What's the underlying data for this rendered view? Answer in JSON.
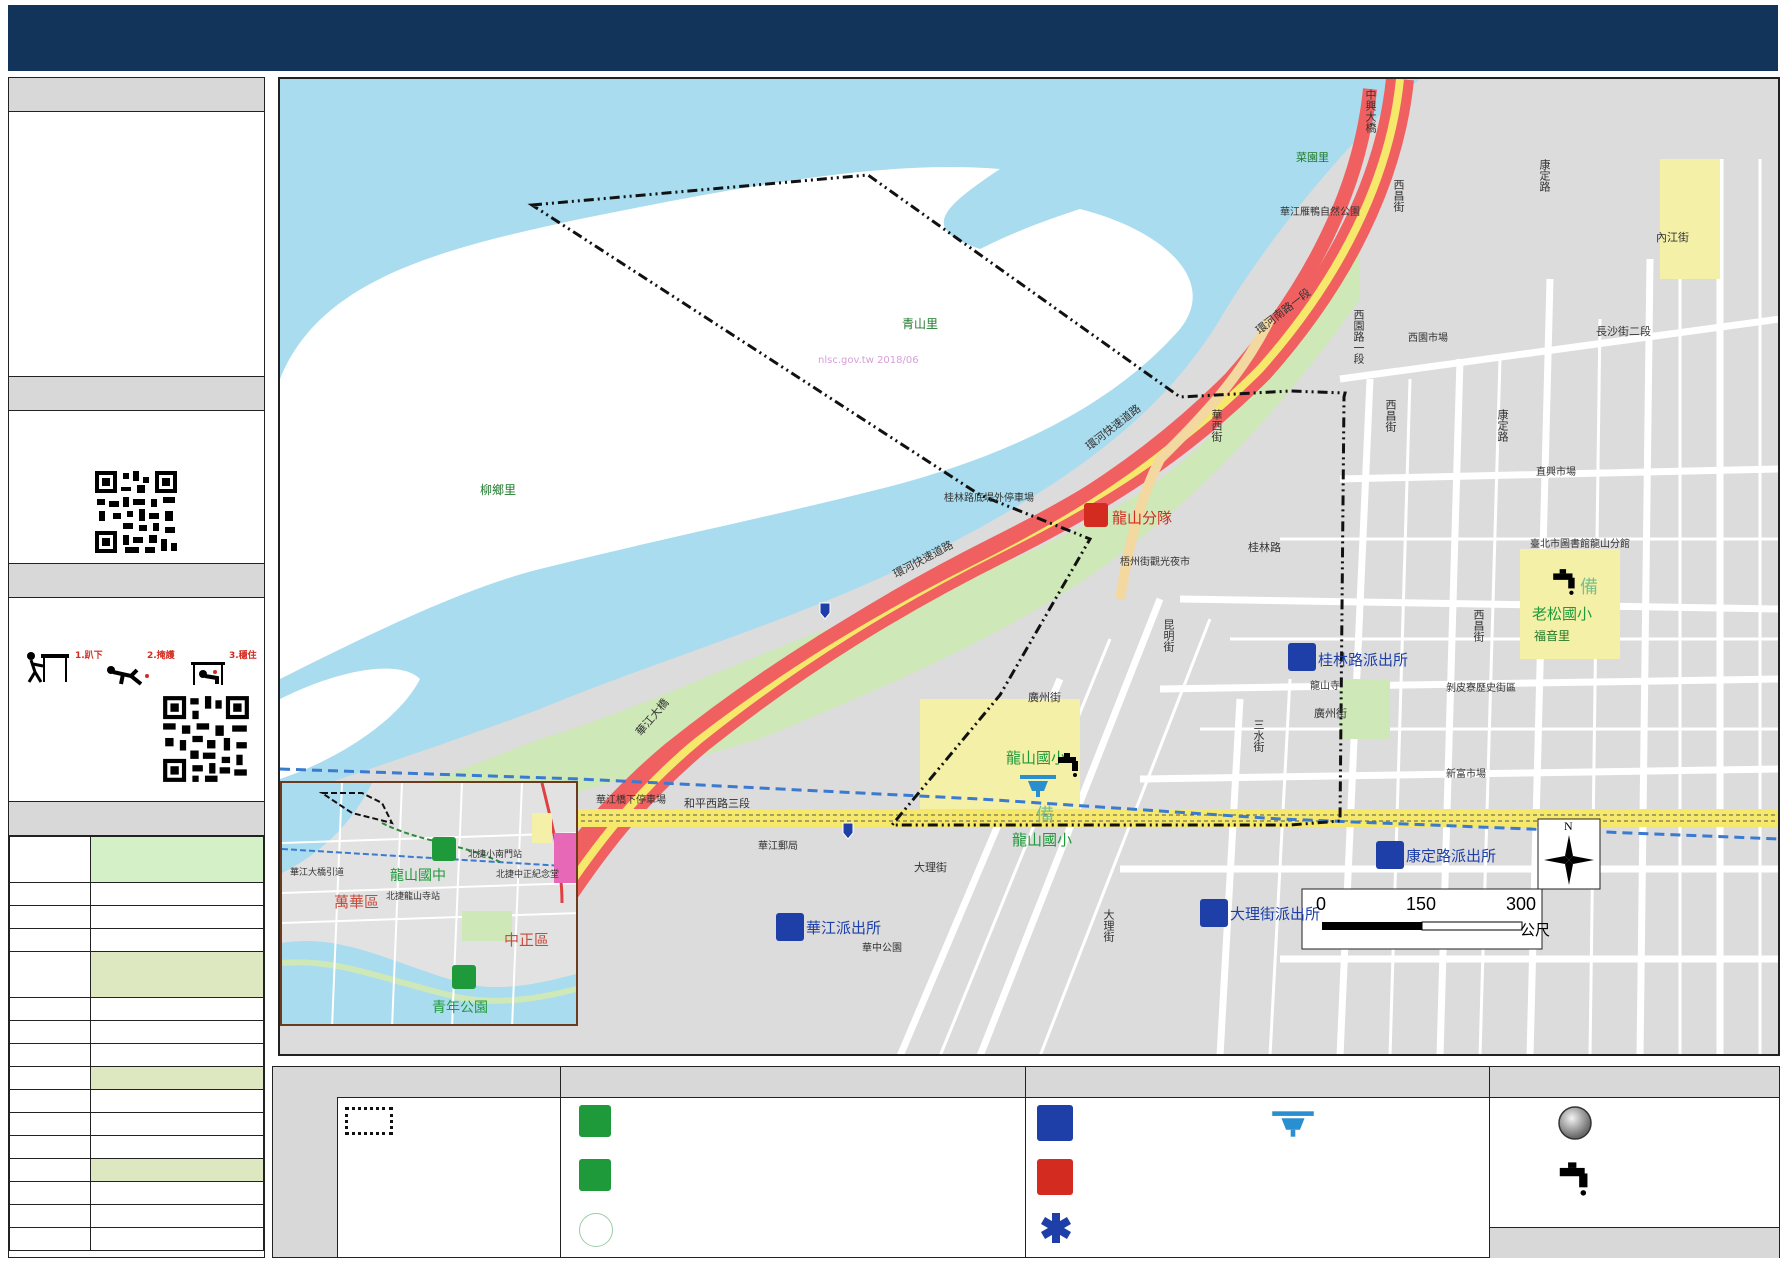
{
  "labels": {
    "chinese_district_1": "萬華區",
    "chinese_district_2": "中正區",
    "shelter_school_1": "龍山國中",
    "shelter_park": "青年公園",
    "shelter_school_2": "龍山國小",
    "shelter_school_3": "老松國小",
    "fire_station": "龍山分隊",
    "police_1": "桂林路派出所",
    "police_2": "康定路派出所",
    "police_3": "華江派出所",
    "police_4": "大理街派出所",
    "village_1": "青山里",
    "village_2": "柳鄉里",
    "village_3": "福音里",
    "watermark": "nlsc.gov.tw 2018/06",
    "spare_mark": "備",
    "river_road_1": "環河快速道路",
    "river_road_2": "環河南路一段",
    "bridge_road": "中興大橋",
    "street_guilin": "桂林路",
    "street_heping": "和平西路三段",
    "street_kangding": "康定路",
    "street_xichang": "西昌街",
    "street_neijiang": "內江街",
    "street_dali": "大理街",
    "street_guangzhou": "廣州街",
    "street_sanshui": "三水街",
    "street_xiyuan": "西園路一段",
    "street_huaxi": "華西街",
    "street_changsha": "長沙街二段",
    "street_kunming": "昆明街",
    "bridge_huajiang": "華江大橋",
    "landmark_cai": "菜園里",
    "landmark_duck": "華江雁鴨自然公園",
    "landmark_market1": "西園市場",
    "landmark_market2": "直興市場",
    "landmark_guilin_parking": "桂林路底堤外停車場",
    "landmark_heping_parking": "華江橋下停車場",
    "landmark_longshan_temple": "龍山寺",
    "landmark_night_market": "梧州街觀光夜市",
    "landmark_library": "臺北市圖書館龍山分館",
    "landmark_xinfu": "新富市場",
    "landmark_bopiliao": "剝皮寮歷史街區",
    "landmark_huajiang_post": "華江郵局",
    "landmark_keelung_park": "華中公園",
    "inset_label_1": "華江大橋引道",
    "inset_label_2": "北捷龍山寺站",
    "inset_label_3": "北捷小南門站",
    "inset_label_4": "北捷中正紀念堂",
    "scale_0": "0",
    "scale_150": "150",
    "scale_300": "300",
    "scale_unit": "公尺",
    "north": "N",
    "drill_step_1": "1.趴下",
    "drill_step_2": "2.掩護",
    "drill_step_3": "3.穩住"
  },
  "colors": {
    "title_bar": "#12335a",
    "river": "#a8dcee",
    "land_green": "#cfe8b8",
    "highway_red": "#f06060",
    "highway_yellow": "#f6e86a",
    "block_gray": "#dcdcdc",
    "street_white": "#ffffff",
    "school_yellow": "#f5f0a8",
    "police_blue": "#1e3fa8",
    "fire_red": "#d42b20",
    "shelter_green": "#1f9a3a",
    "panel_header": "#d8d8d8",
    "table_green": "#d3f0c6",
    "table_olive": "#dde8c0"
  },
  "icons": [
    "qr-code-icon",
    "drill-figure-icon",
    "shelter-building-icon",
    "shelter-park-icon",
    "spare-shelter-icon",
    "police-icon",
    "fire-icon",
    "ambulance-icon",
    "helicopter-icon",
    "water-tap-icon",
    "sphere-icon",
    "compass-icon"
  ]
}
